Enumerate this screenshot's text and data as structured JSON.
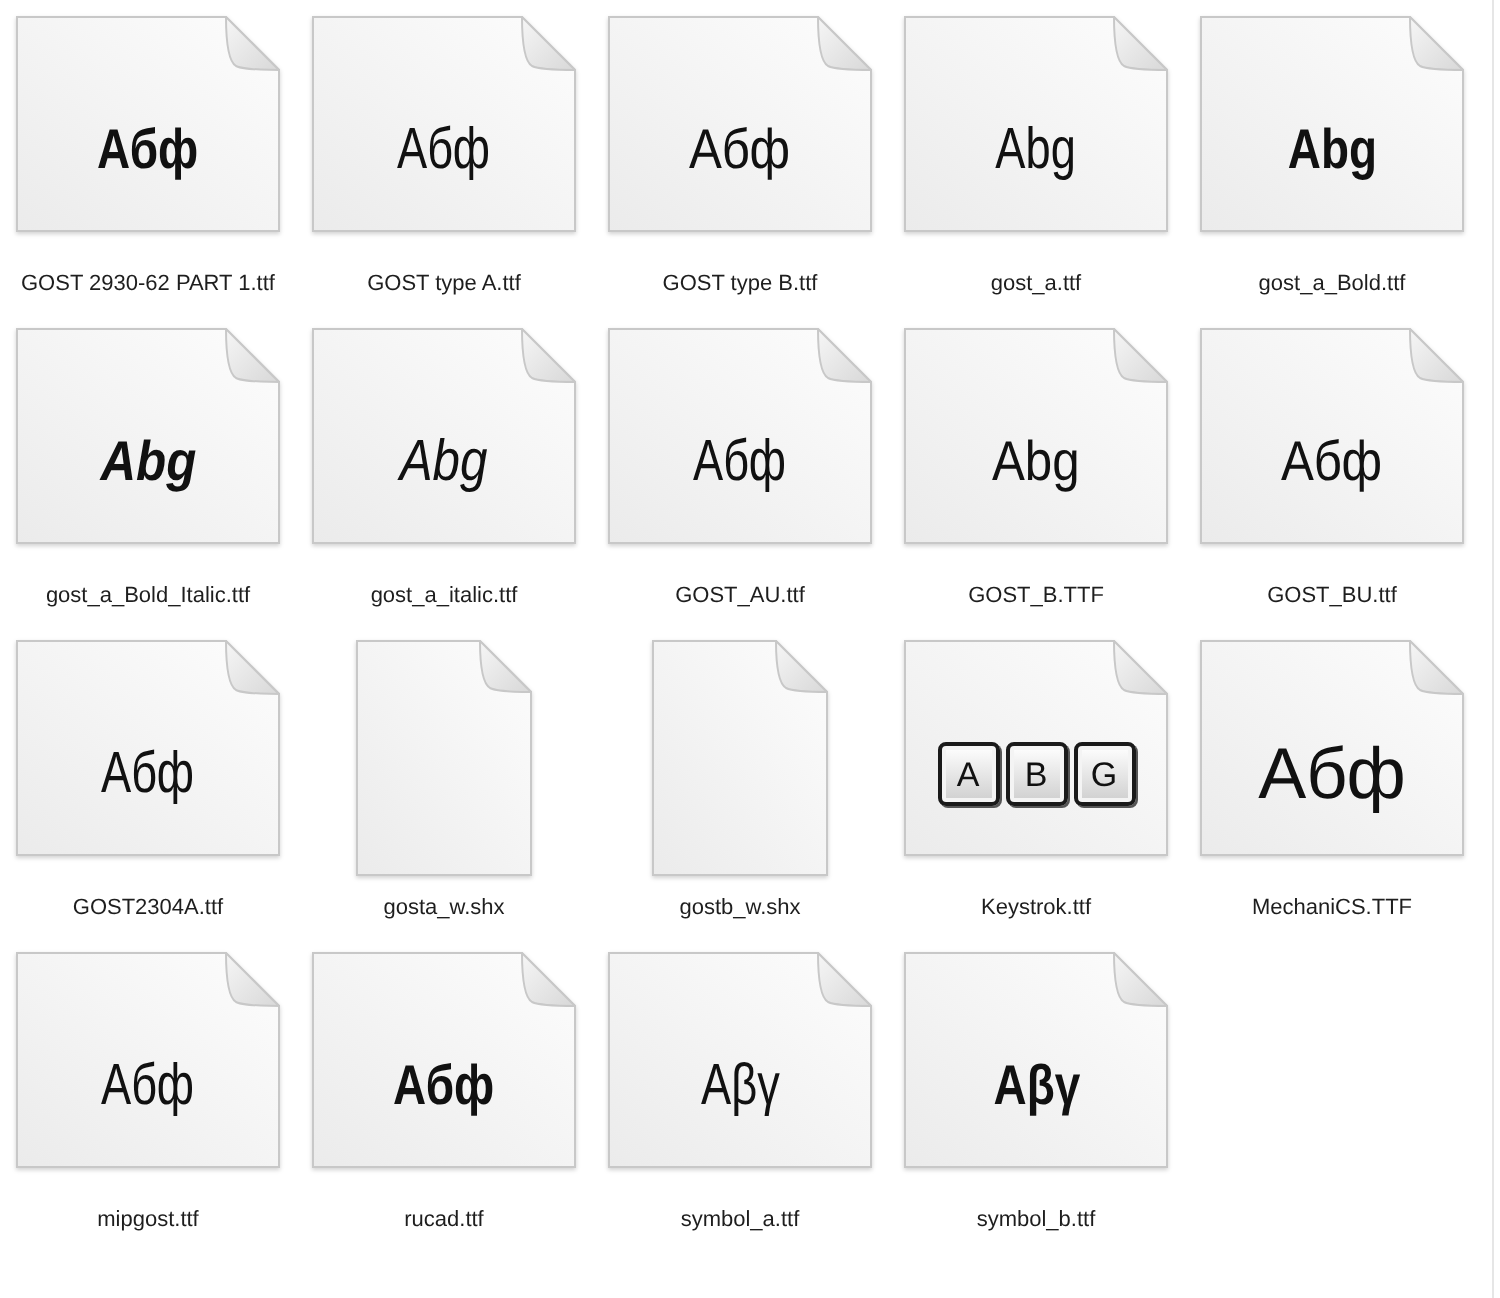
{
  "files": [
    {
      "name": "GOST 2930-62 PART 1.ttf",
      "kind": "bold",
      "preview": "Абф"
    },
    {
      "name": "GOST type A.ttf",
      "kind": "light",
      "preview": "Абф"
    },
    {
      "name": "GOST type B.ttf",
      "kind": "regular",
      "preview": "Абф"
    },
    {
      "name": "gost_a.ttf",
      "kind": "light",
      "preview": "Abg"
    },
    {
      "name": "gost_a_Bold.ttf",
      "kind": "bold",
      "preview": "Abg"
    },
    {
      "name": "gost_a_Bold_Italic.ttf",
      "kind": "bolditalic",
      "preview": "Abg"
    },
    {
      "name": "gost_a_italic.ttf",
      "kind": "italic",
      "preview": "Abg"
    },
    {
      "name": "GOST_AU.ttf",
      "kind": "light",
      "preview": "Абф"
    },
    {
      "name": "GOST_B.TTF",
      "kind": "regular",
      "preview": "Abg"
    },
    {
      "name": "GOST_BU.ttf",
      "kind": "regular",
      "preview": "Абф"
    },
    {
      "name": "GOST2304A.ttf",
      "kind": "light",
      "preview": "Абф"
    },
    {
      "name": "gosta_w.shx",
      "kind": "blank"
    },
    {
      "name": "gostb_w.shx",
      "kind": "blank"
    },
    {
      "name": "Keystrok.ttf",
      "kind": "keycaps",
      "keys": [
        "A",
        "B",
        "G"
      ]
    },
    {
      "name": "MechaniCS.TTF",
      "kind": "large",
      "preview": "Абф"
    },
    {
      "name": "mipgost.ttf",
      "kind": "light",
      "preview": "Абф"
    },
    {
      "name": "rucad.ttf",
      "kind": "bold",
      "preview": "Абф"
    },
    {
      "name": "symbol_a.ttf",
      "kind": "light",
      "preview": "Αβγ"
    },
    {
      "name": "symbol_b.ttf",
      "kind": "bold",
      "preview": "Αβγ"
    }
  ]
}
